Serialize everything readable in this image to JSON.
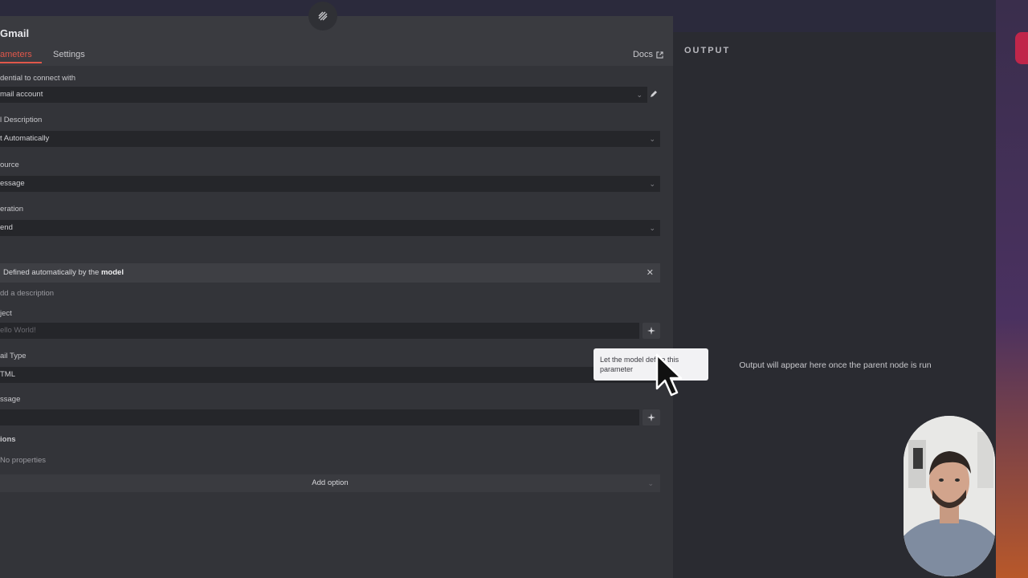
{
  "node": {
    "title": "Gmail",
    "tabs": {
      "parameters": "ameters",
      "settings": "Settings"
    },
    "docs_label": "Docs"
  },
  "fields": {
    "credential": {
      "label": "dential to connect with",
      "value": "mail account"
    },
    "tool_description": {
      "label": "l Description",
      "value": "t Automatically"
    },
    "resource": {
      "label": "ource",
      "value": "essage"
    },
    "operation": {
      "label": "eration",
      "value": "end"
    },
    "to": {
      "auto_text_prefix": "Defined automatically by the ",
      "auto_text_bold": "model",
      "add_description": "dd a description"
    },
    "subject": {
      "label": "ject",
      "placeholder": "ello World!"
    },
    "email_type": {
      "label": "ail Type",
      "value": "TML"
    },
    "message": {
      "label": "ssage",
      "value": ""
    },
    "options": {
      "label": "ions",
      "empty_text": "No properties",
      "add_option": "Add option"
    }
  },
  "tooltip": {
    "text": "Let the model define this parameter"
  },
  "output": {
    "title": "OUTPUT",
    "message": "Output will appear here once the parent node is run"
  },
  "colors": {
    "accent": "#e0574a",
    "panel": "#333439",
    "input": "#25262a",
    "output_panel": "#2a2b31"
  }
}
